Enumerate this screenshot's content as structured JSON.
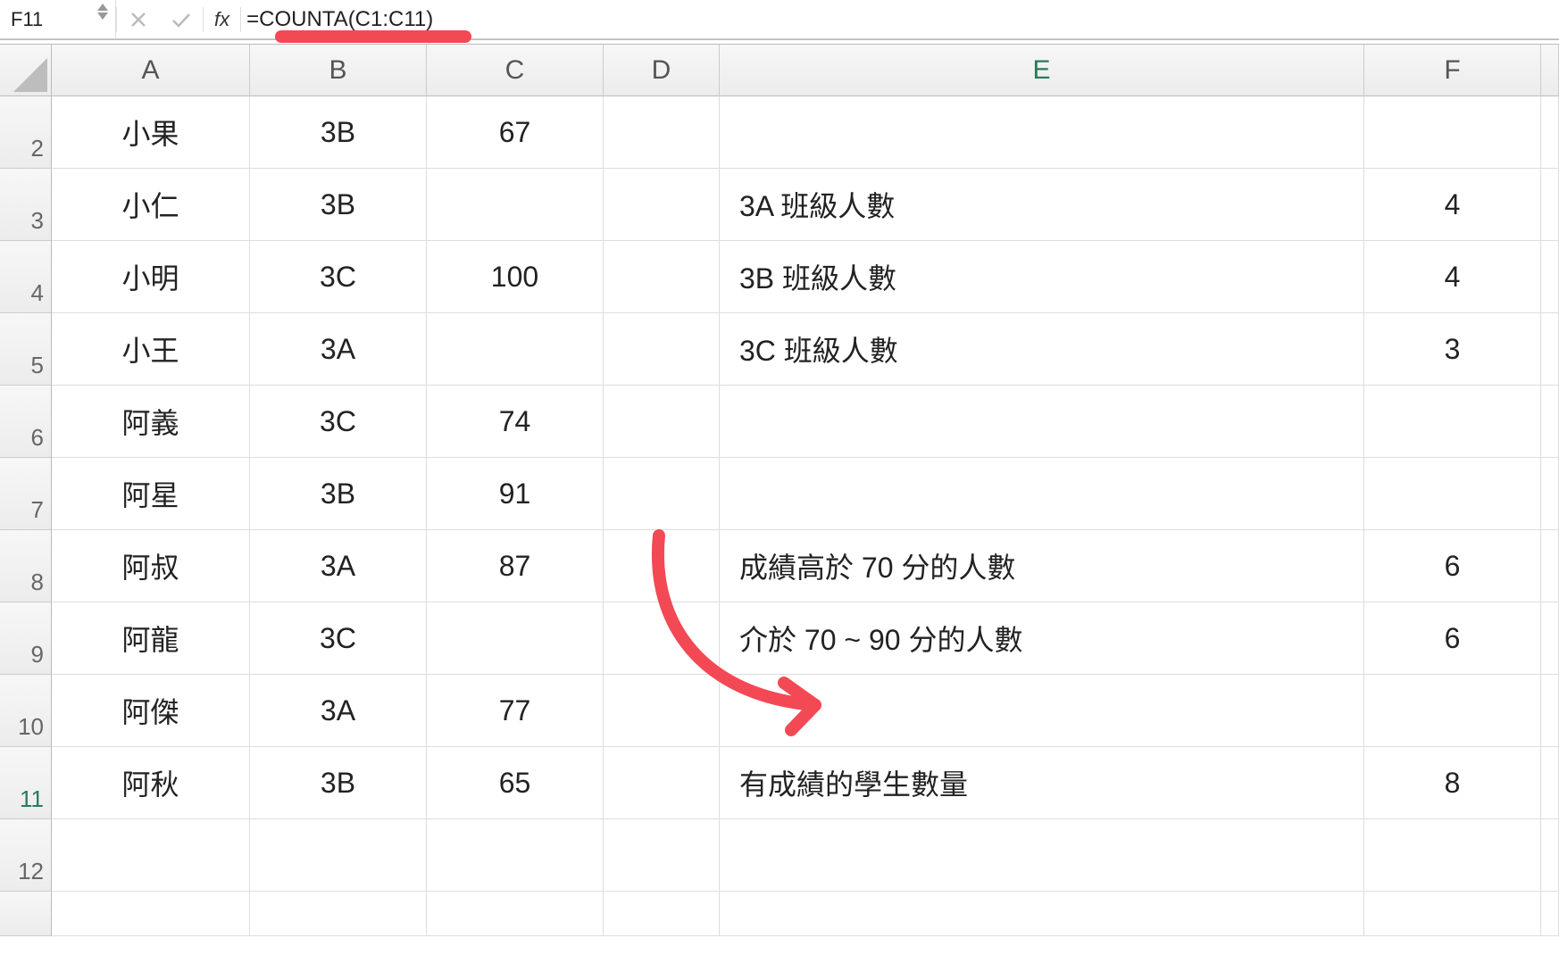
{
  "formula_bar": {
    "namebox": "F11",
    "fx_label": "fx",
    "formula": "=COUNTA(C1:C11)"
  },
  "columns": [
    "A",
    "B",
    "C",
    "D",
    "E",
    "F"
  ],
  "row_numbers": [
    "2",
    "3",
    "4",
    "5",
    "6",
    "7",
    "8",
    "9",
    "10",
    "11",
    "12"
  ],
  "selected_row": "11",
  "data_rows": [
    {
      "a": "小果",
      "b": "3B",
      "c": "67",
      "e": "",
      "f": ""
    },
    {
      "a": "小仁",
      "b": "3B",
      "c": "",
      "e": "3A 班級人數",
      "f": "4"
    },
    {
      "a": "小明",
      "b": "3C",
      "c": "100",
      "e": "3B 班級人數",
      "f": "4"
    },
    {
      "a": "小王",
      "b": "3A",
      "c": "",
      "e": "3C 班級人數",
      "f": "3"
    },
    {
      "a": "阿義",
      "b": "3C",
      "c": "74",
      "e": "",
      "f": ""
    },
    {
      "a": "阿星",
      "b": "3B",
      "c": "91",
      "e": "",
      "f": ""
    },
    {
      "a": "阿叔",
      "b": "3A",
      "c": "87",
      "e": "成績高於 70 分的人數",
      "f": "6"
    },
    {
      "a": "阿龍",
      "b": "3C",
      "c": "",
      "e": "介於 70 ~ 90 分的人數",
      "f": "6"
    },
    {
      "a": "阿傑",
      "b": "3A",
      "c": "77",
      "e": "",
      "f": ""
    },
    {
      "a": "阿秋",
      "b": "3B",
      "c": "65",
      "e": "有成績的學生數量",
      "f": "8"
    },
    {
      "a": "",
      "b": "",
      "c": "",
      "e": "",
      "f": ""
    }
  ],
  "annotation": {
    "color": "#f34955"
  }
}
